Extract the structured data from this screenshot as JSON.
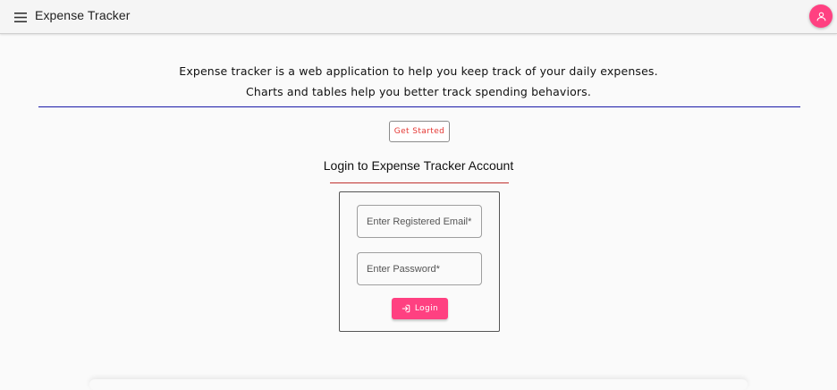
{
  "header": {
    "menu_icon": "menu-icon",
    "title": "Expense Tracker",
    "account_icon": "person-icon",
    "accent_color": "#ff4081"
  },
  "intro": {
    "line1": "Expense tracker is a web application to help you keep track of your daily expenses.",
    "line2": "Charts and tables help you better track spending behaviors."
  },
  "get_started": {
    "label": "Get Started"
  },
  "login": {
    "heading": "Login to Expense Tracker Account",
    "email_placeholder": "Enter Registered Email*",
    "email_value": "",
    "password_placeholder": "Enter Password*",
    "password_value": "",
    "button_label": "Login",
    "button_icon": "login-icon"
  }
}
